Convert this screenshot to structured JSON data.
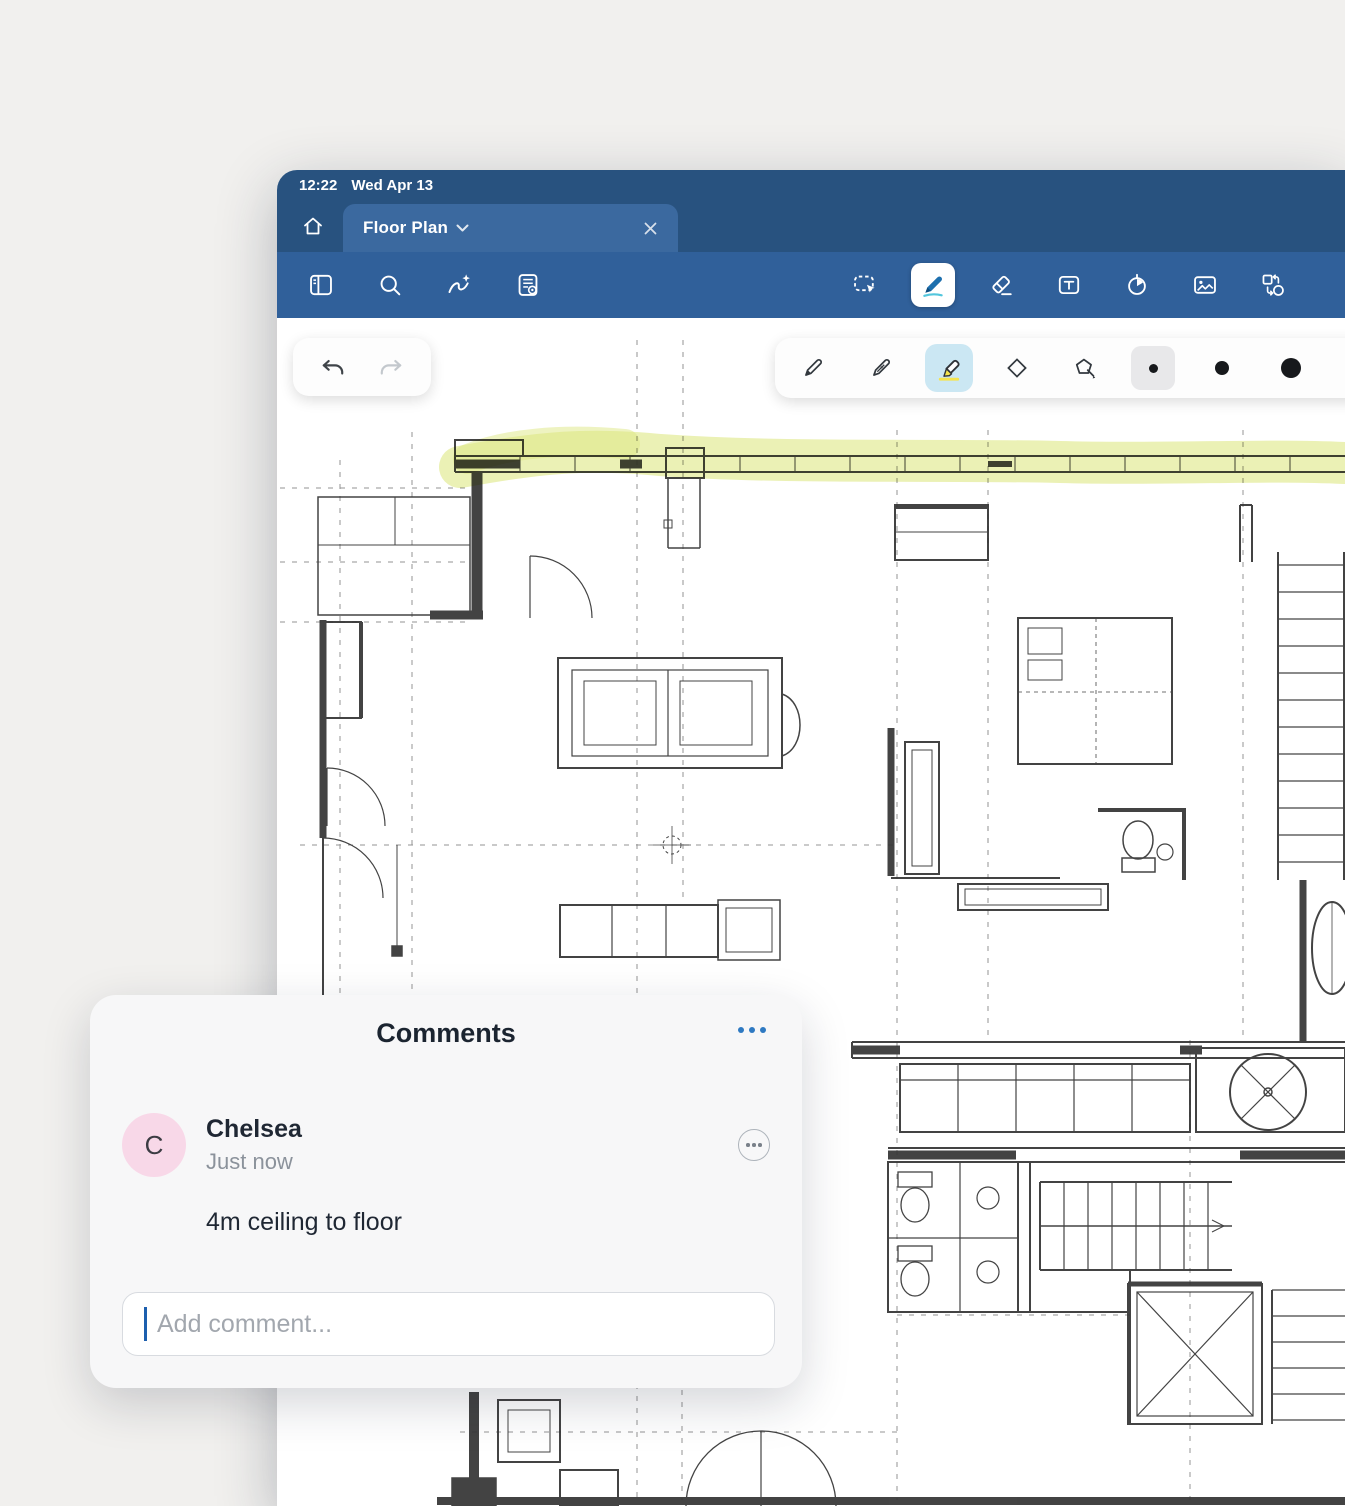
{
  "status_bar": {
    "time": "12:22",
    "date": "Wed Apr 13"
  },
  "tab_bar": {
    "tab_label": "Floor Plan"
  },
  "toolbar": {
    "left_tools": [
      "sidebar-icon",
      "search-icon",
      "lasso-gesture-icon",
      "page-preview-icon"
    ],
    "right_tools": [
      "select-icon",
      "pen-icon",
      "eraser-icon",
      "text-icon",
      "timer-icon",
      "image-icon",
      "shapes-icon"
    ],
    "selected_tool": "pen"
  },
  "pen_bar": {
    "tools": [
      "ballpoint-pen-icon",
      "fountain-pen-icon",
      "highlighter-icon",
      "shape-icon",
      "shape-recognition-icon"
    ],
    "selected_pen": "highlighter",
    "sizes": [
      "small",
      "medium",
      "large"
    ],
    "selected_size": "small"
  },
  "comments": {
    "title": "Comments",
    "item": {
      "initial": "C",
      "name": "Chelsea",
      "time": "Just now",
      "text": "4m ceiling to floor"
    },
    "input_placeholder": "Add comment..."
  },
  "colors": {
    "chrome_blue": "#30609a",
    "chrome_dark": "#28527f",
    "tab_active": "#3b699f",
    "highlighter": "#dde884",
    "accent_blue": "#2e79c2",
    "avatar_pink": "#f8d8e8",
    "pen_selected_bg": "#cbe7f3"
  }
}
